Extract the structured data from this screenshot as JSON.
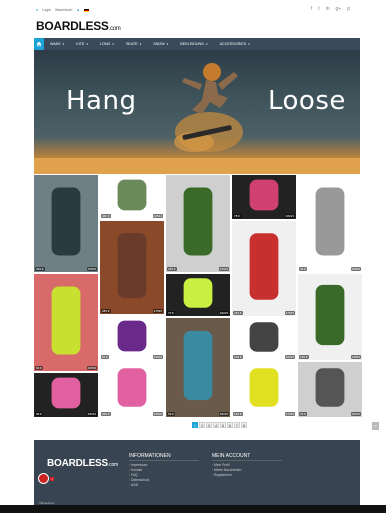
{
  "topbar": {
    "login": "Login",
    "cart": "Warenkorb",
    "social": [
      "f",
      "t",
      "in",
      "g+",
      "p"
    ]
  },
  "logo": {
    "main": "BOARDLESS",
    "suffix": ".com"
  },
  "nav": {
    "home_icon": "home-icon",
    "items": [
      "WAKE",
      "KITE",
      "LONG",
      "SKATE",
      "SNOW",
      "BEKLEIDUNG",
      "ACCESSORIES"
    ]
  },
  "hero": {
    "left": "Hang",
    "right": "Loose"
  },
  "products": [
    {
      "price": "399 €",
      "count": "46509"
    },
    {
      "price": "460 €",
      "count": "46531"
    },
    {
      "price": "286 €",
      "count": "46509"
    },
    {
      "price": "78 €",
      "count": "48223"
    },
    {
      "price": "40 €",
      "count": "46509"
    },
    {
      "price": "289 €",
      "count": "37535"
    },
    {
      "price": "79 €",
      "count": "48225"
    },
    {
      "price": "249 €",
      "count": "37535"
    },
    {
      "price": "60 €",
      "count": "46509"
    },
    {
      "price": "55 €",
      "count": "46509"
    },
    {
      "price": "125 €",
      "count": "48225"
    },
    {
      "price": "189 €",
      "count": "44865"
    },
    {
      "price": "399 €",
      "count": "46509"
    },
    {
      "price": "59 €",
      "count": "48225"
    },
    {
      "price": "38 €",
      "count": "48223"
    },
    {
      "price": "159 €",
      "count": "37535"
    },
    {
      "price": "25 €",
      "count": "48225"
    },
    {
      "price": "58 €",
      "count": "48223"
    }
  ],
  "pagination": {
    "pages": [
      "1",
      "2",
      "3",
      "4",
      "5",
      "6",
      "7",
      "8"
    ],
    "next": "»"
  },
  "footer": {
    "logo": "BOARDLESS",
    "logo_suffix": ".com",
    "info_title": "INFORMATIONEN",
    "info_links": [
      "Impressum",
      "Kontakt",
      "FAQ",
      "Datenschutz",
      "AGB"
    ],
    "account_title": "MEIN ACCOUNT",
    "account_links": [
      "Mein Profil",
      "Meine Nachrichten",
      "Registrieren"
    ],
    "note": "©Boardless"
  }
}
